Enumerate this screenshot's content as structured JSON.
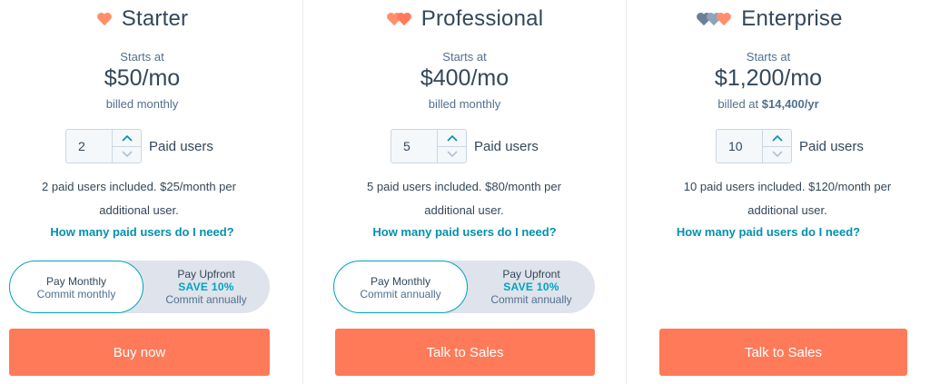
{
  "colors": {
    "accent": "#ff7a59",
    "link": "#0091ae",
    "teal": "#00a4bd",
    "heart_light": "#ffbfa8",
    "heart_mid": "#ff8f6b",
    "heart_blue": "#6a7f98"
  },
  "plans": [
    {
      "name": "Starter",
      "starts_at": "Starts at",
      "price": "$50/mo",
      "billed_text": "billed monthly",
      "users_value": "2",
      "users_label": "Paid users",
      "description": "2 paid users included. $25/month per additional user.",
      "help_link": "How many paid users do I need?",
      "toggle": {
        "monthly_title": "Pay Monthly",
        "monthly_sub": "Commit monthly",
        "upfront_title": "Pay Upfront",
        "upfront_save": "SAVE 10%",
        "upfront_sub": "Commit annually"
      },
      "cta": "Buy now"
    },
    {
      "name": "Professional",
      "starts_at": "Starts at",
      "price": "$400/mo",
      "billed_text": "billed monthly",
      "users_value": "5",
      "users_label": "Paid users",
      "description": "5 paid users included. $80/month per additional user.",
      "help_link": "How many paid users do I need?",
      "toggle": {
        "monthly_title": "Pay Monthly",
        "monthly_sub": "Commit annually",
        "upfront_title": "Pay Upfront",
        "upfront_save": "SAVE 10%",
        "upfront_sub": "Commit annually"
      },
      "cta": "Talk to Sales"
    },
    {
      "name": "Enterprise",
      "starts_at": "Starts at",
      "price": "$1,200/mo",
      "billed_prefix": "billed at",
      "billed_amount": "$14,400/yr",
      "users_value": "10",
      "users_label": "Paid users",
      "description": "10 paid users included. $120/month per additional user.",
      "help_link": "How many paid users do I need?",
      "cta": "Talk to Sales"
    }
  ],
  "icons": {
    "hearts": "heart-icon",
    "up": "chevron-up-icon",
    "down": "chevron-down-icon"
  }
}
